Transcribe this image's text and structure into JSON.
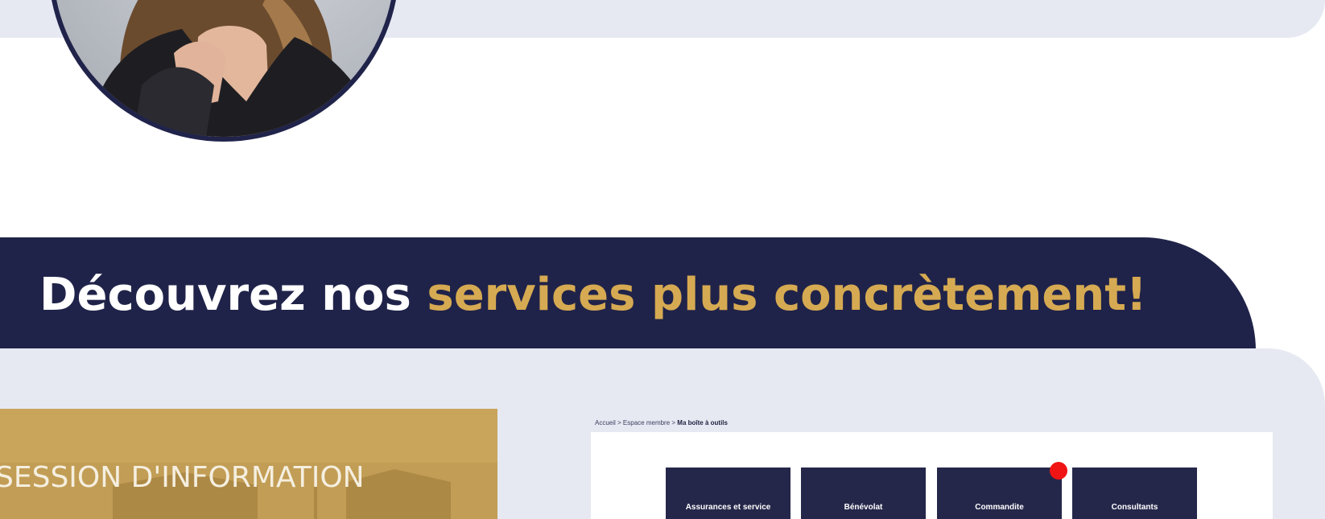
{
  "banner": {
    "title_main": "Découvrez nos ",
    "title_accent": "services plus concrètement!"
  },
  "promo": {
    "title": "SESSION D'INFORMATION"
  },
  "toolbox": {
    "breadcrumb": {
      "home": "Accueil",
      "separator": " > ",
      "member": "Espace membre",
      "current": "Ma boîte à outils"
    },
    "tiles": [
      {
        "label": "Assurances et service"
      },
      {
        "label": "Bénévolat"
      },
      {
        "label": "Commandite"
      },
      {
        "label": "Consultants"
      }
    ]
  },
  "colors": {
    "navy": "#202349",
    "gold": "#d6aa52",
    "light_band": "#e6e9f2",
    "notification": "#f01414"
  }
}
